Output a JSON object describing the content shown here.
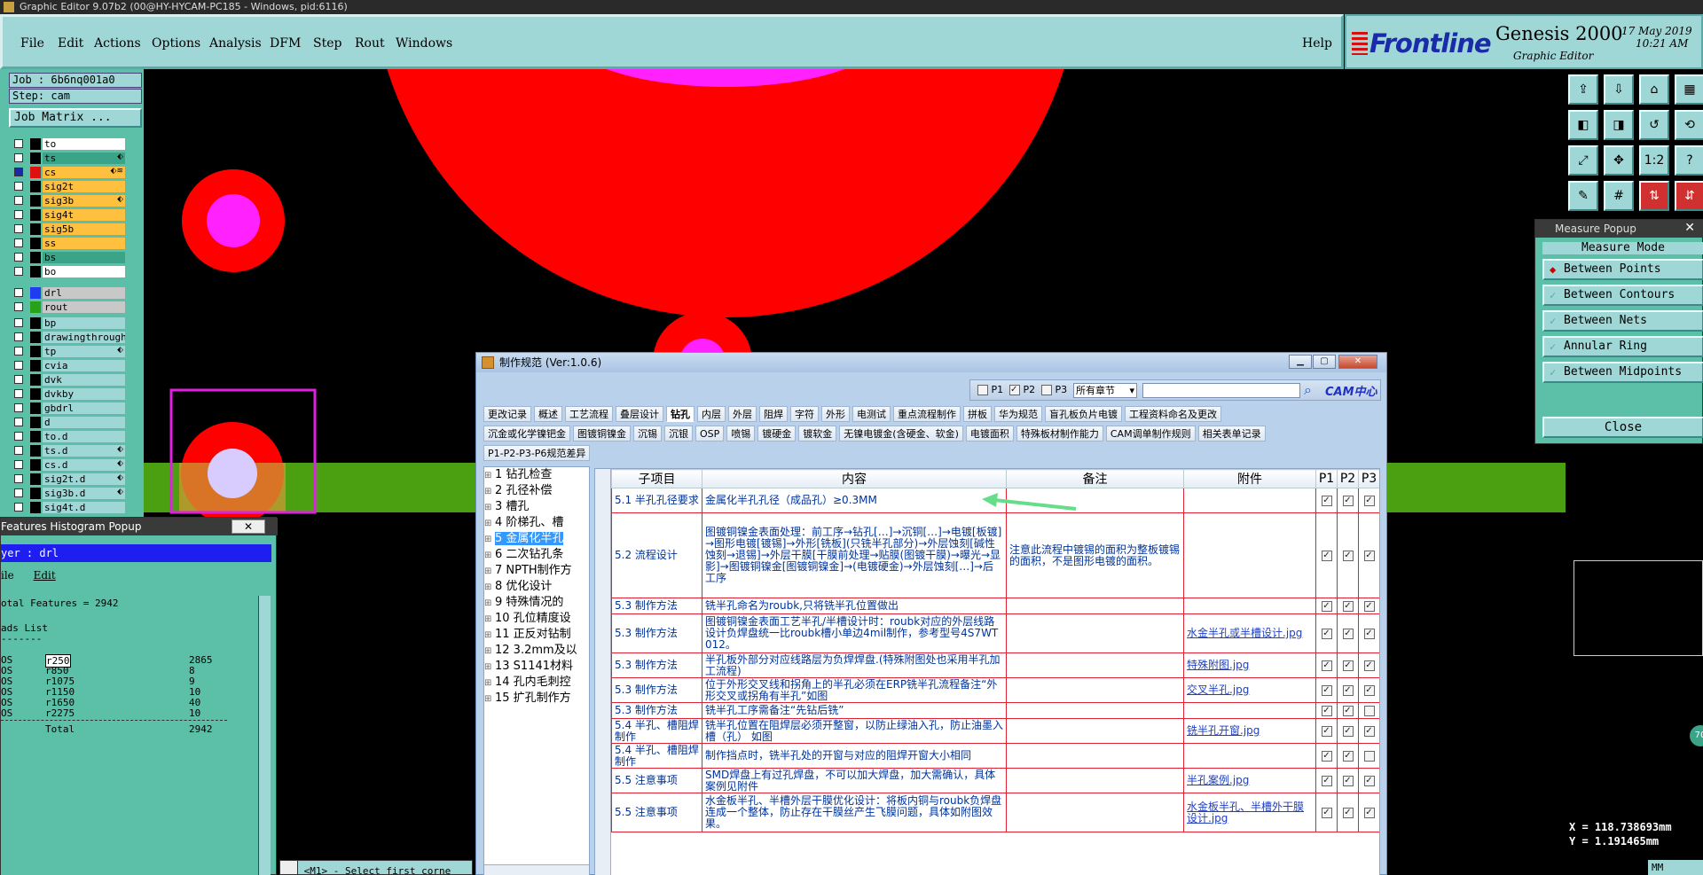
{
  "window_title": "Graphic Editor 9.07b2 (00@HY-HYCAM-PC185 - Windows, pid:6116)",
  "menu": {
    "items": [
      "File",
      "Edit",
      "Actions",
      "Options",
      "Analysis",
      "DFM",
      "Step",
      "Rout",
      "Windows"
    ],
    "help": "Help"
  },
  "brand": {
    "logo": "Frontline",
    "product": "Genesis 2000",
    "subtitle": "Graphic Editor",
    "date": "17 May 2019",
    "time": "10:21 AM"
  },
  "job": {
    "job_label": "Job : 6b6nq001a0",
    "step_label": "Step: cam",
    "matrix_button": "Job Matrix ..."
  },
  "layers_group1": [
    {
      "name": "to",
      "color": "#ffffff",
      "swatch": "#000000",
      "flag": ""
    },
    {
      "name": "ts",
      "color": "#3aa388",
      "swatch": "#000000",
      "flag": "⬖"
    },
    {
      "name": "cs",
      "color": "#ffc040",
      "swatch": "#e01010",
      "flag": "⬖≋",
      "active": true
    },
    {
      "name": "sig2t",
      "color": "#ffc040",
      "swatch": "#000000",
      "flag": ""
    },
    {
      "name": "sig3b",
      "color": "#ffc040",
      "swatch": "#000000",
      "flag": "⬖"
    },
    {
      "name": "sig4t",
      "color": "#ffc040",
      "swatch": "#000000",
      "flag": ""
    },
    {
      "name": "sig5b",
      "color": "#ffc040",
      "swatch": "#000000",
      "flag": ""
    },
    {
      "name": "ss",
      "color": "#ffc040",
      "swatch": "#000000",
      "flag": ""
    },
    {
      "name": "bs",
      "color": "#3aa388",
      "swatch": "#000000",
      "flag": ""
    },
    {
      "name": "bo",
      "color": "#ffffff",
      "swatch": "#000000",
      "flag": ""
    }
  ],
  "layers_group2": [
    {
      "name": "drl",
      "color": "#c8c8c8",
      "swatch": "#1e3cf0",
      "flag": ""
    },
    {
      "name": "rout",
      "color": "#c8c8c8",
      "swatch": "#28a018",
      "flag": ""
    }
  ],
  "layers_group3": [
    {
      "name": "bp",
      "color": "#9fd6d6",
      "swatch": "#000000",
      "flag": ""
    },
    {
      "name": "drawingthrough",
      "color": "#9fd6d6",
      "swatch": "#000000",
      "flag": ""
    },
    {
      "name": "tp",
      "color": "#9fd6d6",
      "swatch": "#000000",
      "flag": "⬖"
    },
    {
      "name": "cvia",
      "color": "#9fd6d6",
      "swatch": "#000000",
      "flag": ""
    },
    {
      "name": "dvk",
      "color": "#9fd6d6",
      "swatch": "#000000",
      "flag": ""
    },
    {
      "name": "dvkby",
      "color": "#9fd6d6",
      "swatch": "#000000",
      "flag": ""
    },
    {
      "name": "gbdrl",
      "color": "#9fd6d6",
      "swatch": "#000000",
      "flag": ""
    },
    {
      "name": "d",
      "color": "#9fd6d6",
      "swatch": "#000000",
      "flag": ""
    },
    {
      "name": "to.d",
      "color": "#9fd6d6",
      "swatch": "#000000",
      "flag": ""
    },
    {
      "name": "ts.d",
      "color": "#9fd6d6",
      "swatch": "#000000",
      "flag": "⬖"
    },
    {
      "name": "cs.d",
      "color": "#9fd6d6",
      "swatch": "#000000",
      "flag": "⬖"
    },
    {
      "name": "sig2t.d",
      "color": "#9fd6d6",
      "swatch": "#000000",
      "flag": "⬖"
    },
    {
      "name": "sig3b.d",
      "color": "#9fd6d6",
      "swatch": "#000000",
      "flag": "⬖"
    },
    {
      "name": "sig4t.d",
      "color": "#9fd6d6",
      "swatch": "#000000",
      "flag": ""
    }
  ],
  "histogram": {
    "title": "Features Histogram Popup",
    "layer": "yer  :  drl",
    "menu_file": "ile",
    "menu_edit": "Edit",
    "total_features": "otal Features = 2942",
    "pads_list": "ads List",
    "dashes": "-------",
    "rows": [
      {
        "type": "OS",
        "sym": "r250",
        "count": "2865",
        "hl": true
      },
      {
        "type": "OS",
        "sym": "r850",
        "count": "8"
      },
      {
        "type": "OS",
        "sym": "r1075",
        "count": "9"
      },
      {
        "type": "OS",
        "sym": "r1150",
        "count": "10"
      },
      {
        "type": "OS",
        "sym": "r1650",
        "count": "40"
      },
      {
        "type": "OS",
        "sym": "r2275",
        "count": "10"
      }
    ],
    "total_label": "Total",
    "total_value": "2942"
  },
  "measure": {
    "title": "Measure Popup",
    "mode_label": "Measure Mode",
    "options": [
      {
        "label": "Between Points",
        "selected": true
      },
      {
        "label": "Between Contours",
        "selected": false
      },
      {
        "label": "Between Nets",
        "selected": false
      },
      {
        "label": "Annular Ring",
        "selected": false
      },
      {
        "label": "Between Midpoints",
        "selected": false
      }
    ],
    "close_label": "Close"
  },
  "coords": {
    "x": "X = 118.738693mm",
    "y": "Y = 1.191465mm"
  },
  "status_text": "<M1> - Select first corne",
  "status_mm": "MM",
  "spec": {
    "title": "制作规范 (Ver:1.0.6)",
    "filters": [
      "P1",
      "P2",
      "P3"
    ],
    "filter_checked": [
      false,
      true,
      false
    ],
    "chapter_select": "所有章节",
    "cam_logo": "CAM中心",
    "tabs_row1": [
      "更改记录",
      "概述",
      "工艺流程",
      "叠层设计",
      "钻孔",
      "内层",
      "外层",
      "阻焊",
      "字符",
      "外形",
      "电测试",
      "重点流程制作",
      "拼板",
      "华为规范",
      "盲孔板负片电镀",
      "工程资料命名及更改"
    ],
    "tabs_row2": [
      "沉金或化学镍钯金",
      "图镀铜镍金",
      "沉锡",
      "沉银",
      "OSP",
      "喷锡",
      "镀硬金",
      "镀软金",
      "无镍电镀金(含硬金、软金)",
      "电镀面积",
      "特殊板材制作能力",
      "CAM调单制作规则",
      "相关表单记录"
    ],
    "tabs_row3": [
      "P1-P2-P3-P6规范差异"
    ],
    "selected_tab": "钻孔",
    "tree": [
      "1 钻孔检查",
      "2 孔径补偿",
      "3 槽孔",
      "4 阶梯孔、槽",
      "5 金属化半孔",
      "6 二次钻孔条",
      "7 NPTH制作方",
      "8 优化设计",
      "9 特殊情况的",
      "10 孔位精度设",
      "11 正反对钻制",
      "12 3.2mm及以",
      "13 S1141材料",
      "14 孔内毛刺控",
      "15 扩孔制作方"
    ],
    "tree_selected": 4,
    "columns": [
      "子项目",
      "内容",
      "备注",
      "附件",
      "P1",
      "P2",
      "P3"
    ],
    "rows": [
      {
        "sub": "5.1 半孔孔径要求",
        "content": "金属化半孔孔径（成品孔）≥0.3MM",
        "note": "",
        "att": "",
        "p": [
          1,
          1,
          1
        ]
      },
      {
        "sub": "5.2 流程设计",
        "content": "图镀铜镍金表面处理：前工序→钻孔[…]→沉铜[…]→电镀[板镀]→图形电镀[镀锡]→外形[铣板](只铣半孔部分)→外层蚀刻[碱性蚀刻→退锡]→外层干膜[干膜前处理→贴膜(图镀干膜)→曝光→显影]→图镀铜镍金[图镀铜镍金]→(电镀硬金)→外层蚀刻[…]→后工序",
        "note": "注意此流程中镀锡的面积为整板镀锡的面积，不是图形电镀的面积。",
        "att": "",
        "p": [
          1,
          1,
          1
        ]
      },
      {
        "sub": "5.3 制作方法",
        "content": "铣半孔命名为roubk,只将铣半孔位置做出",
        "note": "",
        "att": "",
        "p": [
          1,
          1,
          1
        ]
      },
      {
        "sub": "5.3 制作方法",
        "content": "图镀铜镍金表面工艺半孔/半槽设计时：roubk对应的外层线路设计负焊盘统一比roubk槽小单边4mil制作，参考型号4S7WT012。",
        "note": "",
        "att": "水金半孔或半槽设计.jpg",
        "p": [
          1,
          1,
          1
        ]
      },
      {
        "sub": "5.3 制作方法",
        "content": "半孔板外部分对应线路层为负焊焊盘.(特殊附图处也采用半孔加工流程)",
        "note": "",
        "att": "特殊附图.jpg",
        "p": [
          1,
          1,
          1
        ]
      },
      {
        "sub": "5.3 制作方法",
        "content": "位于外形交叉线和拐角上的半孔必须在ERP铣半孔流程备注“外形交叉或拐角有半孔”如图",
        "note": "",
        "att": "交叉半孔.jpg",
        "p": [
          1,
          1,
          1
        ]
      },
      {
        "sub": "5.3 制作方法",
        "content": "铣半孔工序需备注“先钻后铣”",
        "note": "",
        "att": "",
        "p": [
          1,
          1,
          0
        ]
      },
      {
        "sub": "5.4 半孔、槽阻焊制作",
        "content": "铣半孔位置在阻焊层必须开整窗，以防止绿油入孔，防止油墨入槽（孔）  如图",
        "note": "",
        "att": "铣半孔开窗.jpg",
        "p": [
          1,
          1,
          1
        ]
      },
      {
        "sub": "5.4 半孔、槽阻焊制作",
        "content": "制作挡点时，铣半孔处的开窗与对应的阻焊开窗大小相同",
        "note": "",
        "att": "",
        "p": [
          1,
          1,
          0
        ]
      },
      {
        "sub": "5.5 注意事项",
        "content": "SMD焊盘上有过孔焊盘，不可以加大焊盘，加大需确认，具体案例见附件",
        "note": "",
        "att": "半孔案例.jpg",
        "p": [
          1,
          1,
          1
        ]
      },
      {
        "sub": "5.5 注意事项",
        "content": "水金板半孔、半槽外层干膜优化设计：将板内铜与roubk负焊盘连成一个整体，防止存在干膜丝产生飞膜问题，具体如附图效果。",
        "note": "",
        "att": "水金板半孔、半槽外干膜设计.jpg",
        "p": [
          1,
          1,
          1
        ]
      }
    ]
  },
  "colors": {
    "panel": "#5cc0a8",
    "menu": "#9fd6d6",
    "pad_red": "#ff0000",
    "pad_magenta": "#ff22ff",
    "drill_band": "#4aa010",
    "select_box": "#e020e0",
    "arrow": "#66dd88"
  }
}
